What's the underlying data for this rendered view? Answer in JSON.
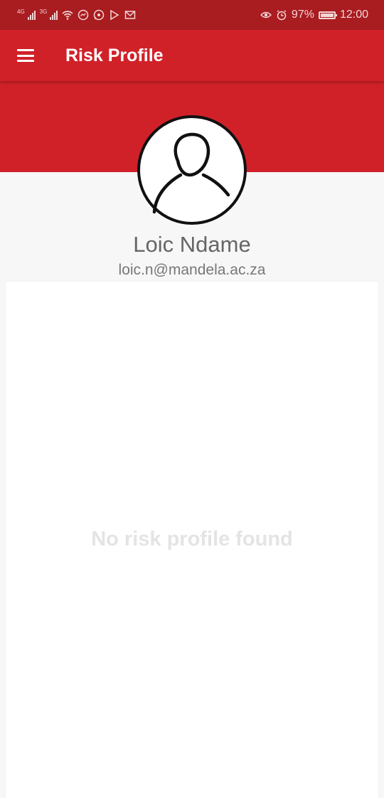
{
  "status_bar": {
    "network_1": "4G",
    "network_2": "3G",
    "battery": "97%",
    "time": "12:00"
  },
  "appbar": {
    "title": "Risk Profile"
  },
  "profile": {
    "name": "Loic Ndame",
    "email": "loic.n@mandela.ac.za"
  },
  "content": {
    "empty_message": "No risk profile found"
  },
  "colors": {
    "primary": "#d02129",
    "status_bar": "#a91c20",
    "background": "#f7f7f7",
    "card": "#ffffff"
  },
  "icons": {
    "menu": "hamburger-menu-icon",
    "avatar": "user-avatar-icon"
  }
}
